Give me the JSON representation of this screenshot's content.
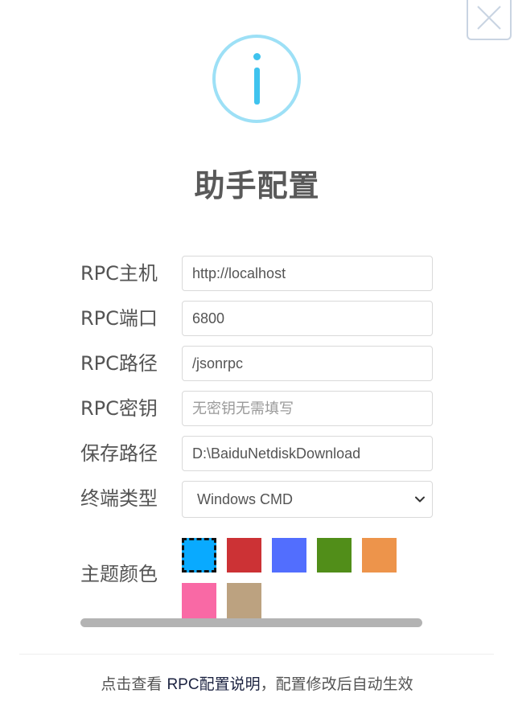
{
  "dialog": {
    "title": "助手配置",
    "icon": "info-icon",
    "close_icon": "close-icon",
    "accent_color": "#3fc3ee"
  },
  "form": {
    "rpc_host": {
      "label": "RPC主机",
      "value": "http://localhost",
      "placeholder": ""
    },
    "rpc_port": {
      "label": "RPC端口",
      "value": "6800",
      "placeholder": ""
    },
    "rpc_path": {
      "label": "RPC路径",
      "value": "/jsonrpc",
      "placeholder": ""
    },
    "rpc_secret": {
      "label": "RPC密钥",
      "value": "",
      "placeholder": "无密钥无需填写"
    },
    "save_path": {
      "label": "保存路径",
      "value": "D:\\BaiduNetdiskDownload",
      "placeholder": ""
    },
    "terminal_type": {
      "label": "终端类型",
      "selected": "Windows CMD"
    },
    "theme": {
      "label": "主题颜色",
      "colors": [
        "#09aaff",
        "#cc3235",
        "#526efe",
        "#518e19",
        "#ed944b",
        "#f969a5",
        "#bca280"
      ],
      "selected_index": 0
    }
  },
  "footer": {
    "prefix": "点击查看 ",
    "link_text": "RPC配置说明",
    "suffix": "，配置修改后自动生效"
  }
}
